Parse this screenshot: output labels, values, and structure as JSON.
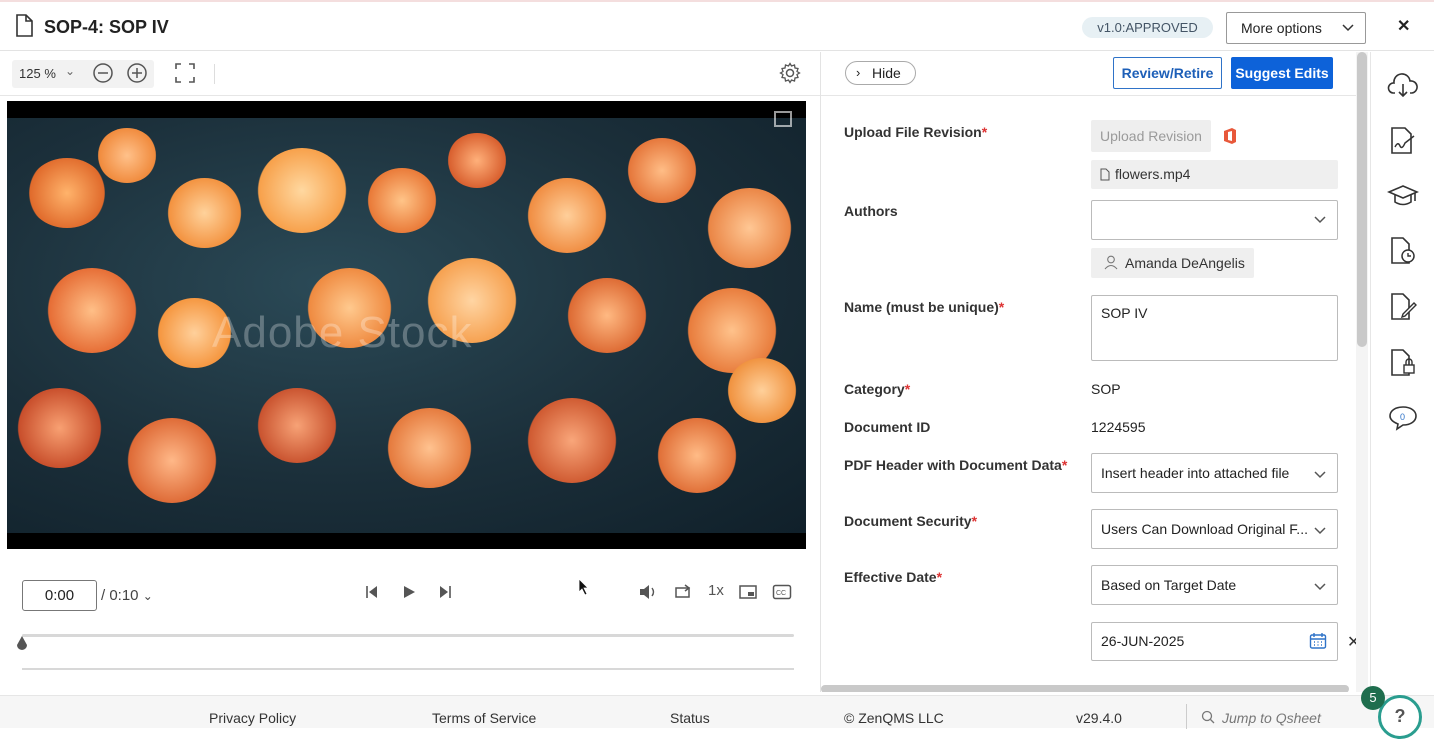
{
  "header": {
    "title": "SOP-4: SOP IV",
    "status_badge": "v1.0:APPROVED",
    "more_options": "More options"
  },
  "toolbar": {
    "zoom_value": "125",
    "zoom_unit": "%"
  },
  "video": {
    "watermark": "Adobe Stock"
  },
  "player": {
    "current_time": "0:00",
    "duration": "/ 0:10",
    "speed": "1x",
    "progress": 0
  },
  "panel": {
    "hide_label": "Hide",
    "review_retire": "Review/Retire",
    "suggest_edits": "Suggest Edits",
    "fields": {
      "upload_file_revision": {
        "label": "Upload File Revision",
        "button": "Upload Revision",
        "file": "flowers.mp4"
      },
      "authors": {
        "label": "Authors",
        "selected": "",
        "chip": "Amanda DeAngelis"
      },
      "name": {
        "label": "Name (must be unique)",
        "value": "SOP IV"
      },
      "category": {
        "label": "Category",
        "value": "SOP"
      },
      "document_id": {
        "label": "Document ID",
        "value": "1224595"
      },
      "pdf_header": {
        "label": "PDF Header with Document Data",
        "value": "Insert header into attached file"
      },
      "document_security": {
        "label": "Document Security",
        "value": "Users Can Download Original F..."
      },
      "effective_date": {
        "label": "Effective Date",
        "value": "Based on Target Date",
        "date": "26-JUN-2025"
      }
    },
    "required_mark": "*"
  },
  "footer": {
    "privacy": "Privacy Policy",
    "terms": "Terms of Service",
    "status": "Status",
    "copyright": "© ZenQMS LLC",
    "version": "v29.4.0",
    "jump_placeholder": "Jump to Qsheet",
    "notification_count": "5",
    "help": "?"
  },
  "colors": {
    "primary": "#0d62d9",
    "required": "#dd3333",
    "badge_bg": "#e7f0f4",
    "help_ring": "#2a9d8f"
  },
  "icons": [
    "document-icon",
    "zoom-out-icon",
    "zoom-in-icon",
    "fit-screen-icon",
    "gear-icon",
    "chevron-right-icon",
    "office-icon",
    "file-icon",
    "user-icon",
    "calendar-icon",
    "cloud-download-icon",
    "signature-icon",
    "training-icon",
    "history-icon",
    "edit-document-icon",
    "lock-document-icon",
    "comment-icon",
    "search-icon"
  ]
}
